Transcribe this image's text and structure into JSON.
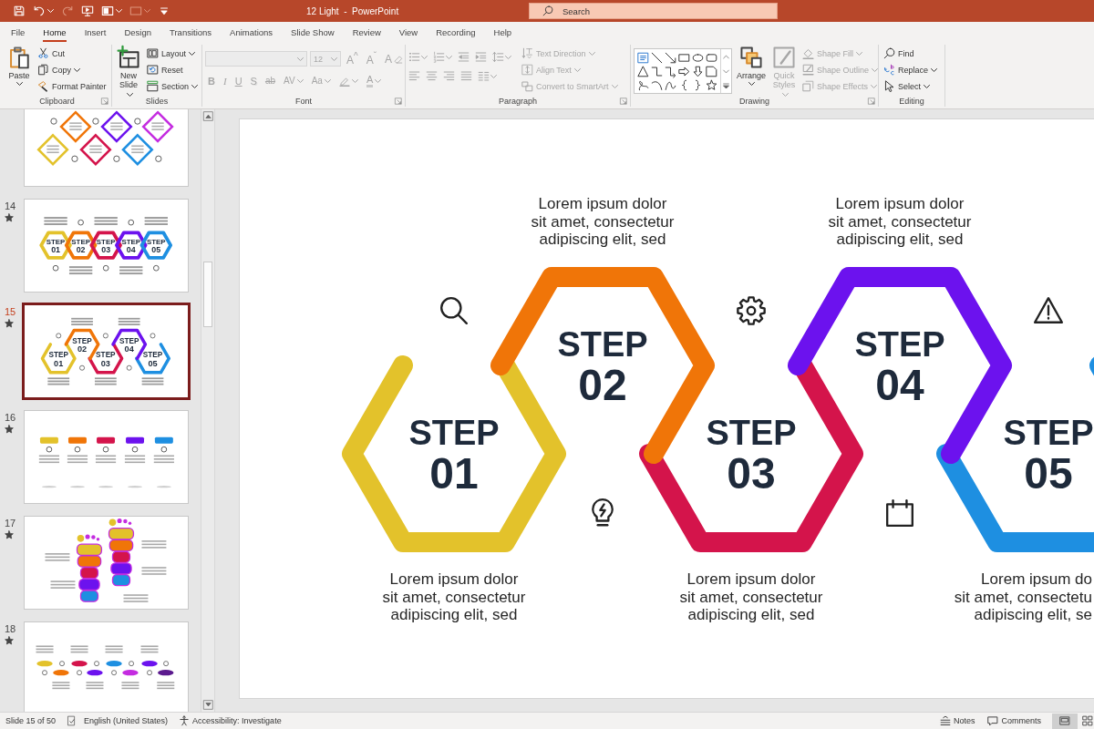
{
  "title_bar": {
    "quick_access": [
      {
        "disabled": false
      },
      {
        "disabled": false
      },
      {
        "disabled": true
      },
      {
        "disabled": false
      },
      {
        "disabled": false
      },
      {
        "disabled": true
      },
      {
        "disabled": false
      }
    ],
    "title": "12 Light  -  PowerPoint",
    "search": {
      "placeholder": "Search"
    }
  },
  "tabs": [
    {
      "label": "File",
      "selected": false
    },
    {
      "label": "Home",
      "selected": true
    },
    {
      "label": "Insert",
      "selected": false
    },
    {
      "label": "Design",
      "selected": false
    },
    {
      "label": "Transitions",
      "selected": false
    },
    {
      "label": "Animations",
      "selected": false
    },
    {
      "label": "Slide Show",
      "selected": false
    },
    {
      "label": "Review",
      "selected": false
    },
    {
      "label": "View",
      "selected": false
    },
    {
      "label": "Recording",
      "selected": false
    },
    {
      "label": "Help",
      "selected": false
    }
  ],
  "ribbon": {
    "clipboard": {
      "label": "Clipboard",
      "paste": {
        "label": "Paste",
        "disabled": false
      },
      "cut": {
        "label": "Cut",
        "disabled": false
      },
      "copy": {
        "label": "Copy",
        "disabled": false
      },
      "format_painter": {
        "label": "Format Painter",
        "disabled": false
      }
    },
    "slides": {
      "label": "Slides",
      "new_slide": {
        "label": "New\nSlide",
        "disabled": false
      },
      "layout": {
        "label": "Layout",
        "disabled": false
      },
      "reset": {
        "label": "Reset",
        "disabled": false
      },
      "section": {
        "label": "Section",
        "disabled": false
      }
    },
    "font": {
      "label": "Font",
      "font_name": {
        "disabled": true
      },
      "font_size": {
        "value": "12",
        "disabled": true
      },
      "top_buttons": [
        {
          "text": "A$^{^}$",
          "disabled": true
        },
        {
          "text": "A$^{ˇ}$",
          "disabled": true
        },
        {
          "text": "A",
          "disabled": true
        }
      ],
      "format_buttons": [
        {
          "kind": "bold",
          "text": "B",
          "disabled": true
        },
        {
          "kind": "italic",
          "text": "I",
          "disabled": true
        },
        {
          "kind": "underline",
          "text": "U",
          "disabled": true
        },
        {
          "kind": "shadow",
          "text": "S",
          "disabled": true
        },
        {
          "kind": "strike",
          "text": "ab",
          "disabled": true
        },
        {
          "kind": "spacing",
          "text": "AV",
          "disabled": true
        },
        {
          "kind": "case",
          "text": "Aa",
          "disabled": true
        },
        {
          "kind": "highlight",
          "disabled": true
        },
        {
          "kind": "color",
          "text": "A",
          "disabled": true
        }
      ]
    },
    "paragraph": {
      "label": "Paragraph",
      "tools": [
        {
          "disabled": true
        },
        {
          "disabled": true
        },
        {
          "disabled": true
        },
        {
          "disabled": true
        },
        {
          "disabled": true
        },
        {
          "disabled": true
        },
        {
          "disabled": true
        },
        {
          "disabled": true
        },
        {
          "disabled": true
        },
        {
          "disabled": true
        }
      ],
      "text_direction": {
        "label": "Text Direction",
        "disabled": true
      },
      "align_text": {
        "label": "Align Text",
        "disabled": true
      },
      "smartart": {
        "label": "Convert to SmartArt",
        "disabled": true
      }
    },
    "drawing": {
      "label": "Drawing",
      "arrange": {
        "label": "Arrange",
        "disabled": false
      },
      "quick_styles": {
        "label": "Quick\nStyles",
        "disabled": true
      },
      "shape_fill": {
        "label": "Shape Fill",
        "disabled": true
      },
      "shape_outline": {
        "label": "Shape Outline",
        "disabled": true
      },
      "shape_effects": {
        "label": "Shape Effects",
        "disabled": true
      }
    },
    "editing": {
      "label": "Editing",
      "find": {
        "label": "Find",
        "disabled": false
      },
      "replace": {
        "label": "Replace",
        "disabled": false
      },
      "select": {
        "label": "Select",
        "disabled": false
      }
    }
  },
  "thumbnails": [
    {
      "selected": false,
      "kind": "diamonds"
    },
    {
      "number": "14",
      "selected": false,
      "animated": true,
      "kind": "hex-row",
      "steps": [
        {
          "title": "STEP",
          "number": "01",
          "color": "#e3c22b"
        },
        {
          "title": "STEP",
          "number": "02",
          "color": "#f07508"
        },
        {
          "title": "STEP",
          "number": "03",
          "color": "#d4144b"
        },
        {
          "title": "STEP",
          "number": "04",
          "color": "#6c12ee"
        },
        {
          "title": "STEP",
          "number": "05",
          "color": "#1e8fe1"
        }
      ]
    },
    {
      "number": "15",
      "selected": true,
      "animated": true,
      "kind": "hex-zigzag",
      "steps": [
        {
          "title": "STEP",
          "number": "01",
          "color": "#e3c22b"
        },
        {
          "title": "STEP",
          "number": "02",
          "color": "#f07508"
        },
        {
          "title": "STEP",
          "number": "03",
          "color": "#d4144b"
        },
        {
          "title": "STEP",
          "number": "04",
          "color": "#6c12ee"
        },
        {
          "title": "STEP",
          "number": "05",
          "color": "#1e8fe1"
        }
      ]
    },
    {
      "number": "16",
      "selected": false,
      "animated": true,
      "kind": "tabs"
    },
    {
      "number": "17",
      "selected": false,
      "animated": true,
      "kind": "footprints"
    },
    {
      "number": "18",
      "selected": false,
      "animated": true,
      "kind": "footprint-row"
    }
  ],
  "slide": {
    "steps": [
      {
        "title": "STEP",
        "number": "01",
        "color": "#e3c22b",
        "caption": "Lorem ipsum dolor\nsit amet, consectetur\nadipiscing elit, sed"
      },
      {
        "title": "STEP",
        "number": "02",
        "color": "#f07508",
        "caption": "Lorem ipsum dolor\nsit amet, consectetur\nadipiscing elit, sed"
      },
      {
        "title": "STEP",
        "number": "03",
        "color": "#d4144b",
        "caption": "Lorem ipsum dolor\nsit amet, consectetur\nadipiscing elit, sed"
      },
      {
        "title": "STEP",
        "number": "04",
        "color": "#6c12ee",
        "caption": "Lorem ipsum dolor\nsit amet, consectetur\nadipiscing elit, sed"
      },
      {
        "title": "STEP",
        "number": "05",
        "color": "#1e8fe1",
        "caption": "Lorem ipsum do\nsit amet, consectetu\nadipiscing elit, se"
      }
    ]
  },
  "status_bar": {
    "slide_info": "Slide 15 of 50",
    "language": "English (United States)",
    "accessibility": "Accessibility: Investigate",
    "notes": "Notes",
    "comments": "Comments",
    "views": [
      {
        "selected": true
      },
      {
        "selected": false
      }
    ]
  }
}
